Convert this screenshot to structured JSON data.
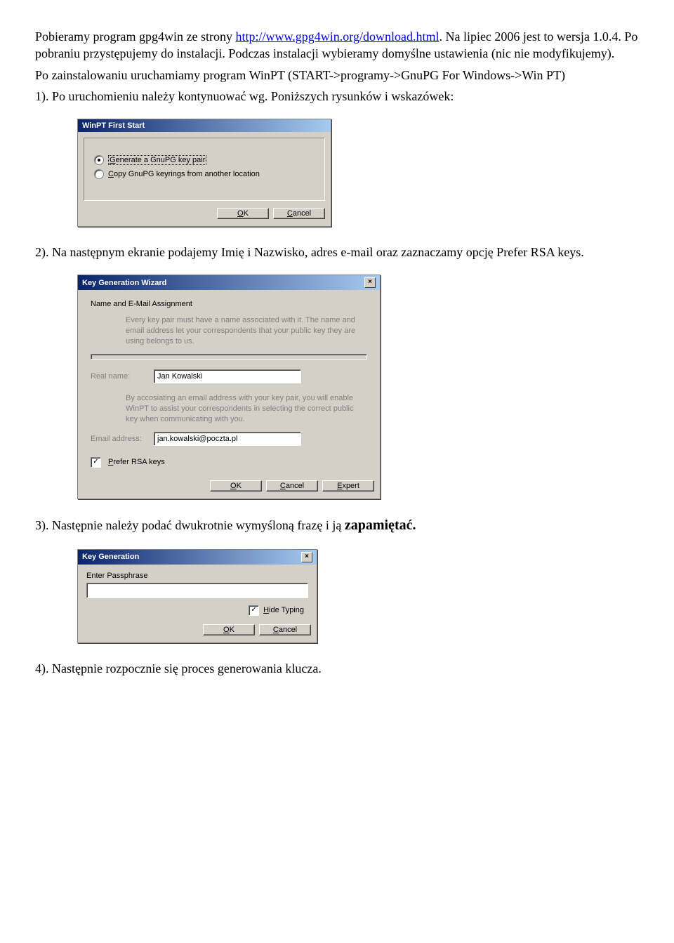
{
  "para1": {
    "t1": "Pobieramy program gpg4win ze strony ",
    "link": "http://www.gpg4win.org/download.html",
    "t2": ". Na lipiec 2006 jest to wersja 1.0.4. Po pobraniu przystępujemy do instalacji. Podczas instalacji wybieramy domyślne ustawienia (nic nie modyfikujemy)."
  },
  "para2_a": "Po zainstalowaniu uruchamiamy program WinPT (START->programy->GnuPG For Windows->Win PT)",
  "para2_b": "1). Po uruchomieniu należy kontynuować wg. Poniższych rysunków i wskazówek:",
  "dlg1": {
    "title": "WinPT First Start",
    "opt1": "Generate a GnuPG key pair",
    "opt2": "Copy GnuPG keyrings from another location",
    "ok": "OK",
    "cancel": "Cancel"
  },
  "para3": "2). Na następnym ekranie podajemy Imię i Nazwisko, adres e-mail oraz zaznaczamy opcję Prefer RSA keys.",
  "dlg2": {
    "title": "Key Generation Wizard",
    "heading": "Name and E-Mail Assignment",
    "desc1": "Every key pair must have a name associated with it. The name and email address let your correspondents that your public key they are using belongs to us.",
    "realname_lbl": "Real name:",
    "realname_val": "Jan Kowalski",
    "desc2": "By accosiating an email address with your key pair, you will enable WinPT to assist your correspondents in selecting the correct public key when communicating with you.",
    "email_lbl": "Email address:",
    "email_val": "jan.kowalski@poczta.pl",
    "prefer": "Prefer RSA keys",
    "ok": "OK",
    "cancel": "Cancel",
    "expert": "Expert"
  },
  "para4_a": "3). Następnie należy podać dwukrotnie wymyśloną frazę i ją ",
  "para4_b": "zapamiętać.",
  "dlg3": {
    "title": "Key Generation",
    "heading": "Enter Passphrase",
    "hide": "Hide Typing",
    "ok": "OK",
    "cancel": "Cancel"
  },
  "para5": "4). Następnie rozpocznie się proces generowania klucza."
}
